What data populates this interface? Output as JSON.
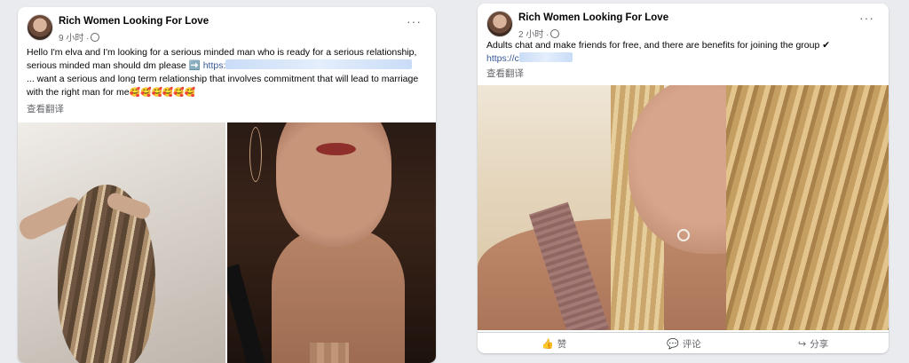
{
  "post1": {
    "author": "Rich Women Looking For Love",
    "time": "9 小时 ·",
    "line1": "Hello I'm elva and I'm looking for a serious minded man who is ready for a serious relationship,",
    "line2": "serious minded man should dm please",
    "arrow": "➡️",
    "link_prefix": "https:",
    "line3": "... want a serious and long term relationship that involves commitment that will lead to marriage",
    "line4": "with the right man for me",
    "emojis": "🥰🥰🥰🥰🥰🥰",
    "translate": "查看翻译",
    "more": "···"
  },
  "post2": {
    "author": "Rich Women Looking For Love",
    "time": "2 小时 ·",
    "line1": "Adults chat and make friends for free, and there are benefits for joining the group",
    "check": "✔",
    "link_prefix": "https://c",
    "translate": "查看翻译",
    "more": "···",
    "actions": {
      "like": "赞",
      "comment": "评论",
      "share": "分享"
    }
  },
  "icons": {
    "like": "thumbs-up-icon",
    "comment": "comment-icon",
    "share": "share-icon",
    "globe": "globe-icon",
    "more": "more-options-icon"
  }
}
